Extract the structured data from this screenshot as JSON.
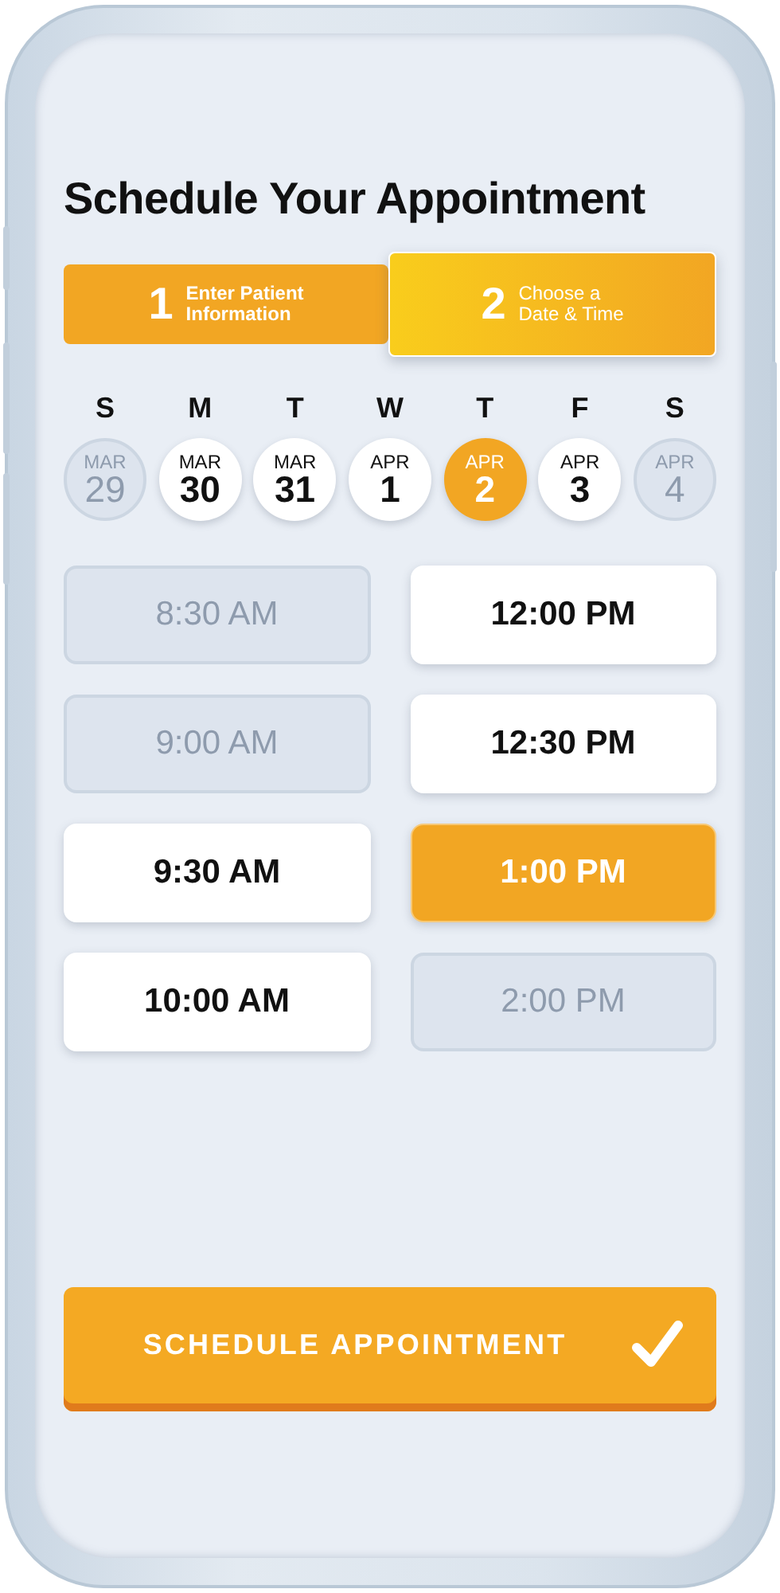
{
  "title": "Schedule Your Appointment",
  "steps": [
    {
      "number": "1",
      "label_line1": "Enter Patient",
      "label_line2": "Information",
      "selected": false
    },
    {
      "number": "2",
      "label_line1": "Choose a",
      "label_line2": "Date & Time",
      "selected": true
    }
  ],
  "days": [
    {
      "weekday": "S",
      "month": "MAR",
      "date": "29",
      "disabled": true,
      "selected": false
    },
    {
      "weekday": "M",
      "month": "MAR",
      "date": "30",
      "disabled": false,
      "selected": false
    },
    {
      "weekday": "T",
      "month": "MAR",
      "date": "31",
      "disabled": false,
      "selected": false
    },
    {
      "weekday": "W",
      "month": "APR",
      "date": "1",
      "disabled": false,
      "selected": false
    },
    {
      "weekday": "T",
      "month": "APR",
      "date": "2",
      "disabled": false,
      "selected": true
    },
    {
      "weekday": "F",
      "month": "APR",
      "date": "3",
      "disabled": false,
      "selected": false
    },
    {
      "weekday": "S",
      "month": "APR",
      "date": "4",
      "disabled": true,
      "selected": false
    }
  ],
  "time_slots": [
    {
      "label": "8:30 AM",
      "disabled": true,
      "selected": false
    },
    {
      "label": "12:00 PM",
      "disabled": false,
      "selected": false
    },
    {
      "label": "9:00 AM",
      "disabled": true,
      "selected": false
    },
    {
      "label": "12:30 PM",
      "disabled": false,
      "selected": false
    },
    {
      "label": "9:30 AM",
      "disabled": false,
      "selected": false
    },
    {
      "label": "1:00 PM",
      "disabled": false,
      "selected": true
    },
    {
      "label": "10:00 AM",
      "disabled": false,
      "selected": false
    },
    {
      "label": "2:00 PM",
      "disabled": true,
      "selected": false
    }
  ],
  "submit_button": {
    "label": "SCHEDULE APPOINTMENT"
  }
}
